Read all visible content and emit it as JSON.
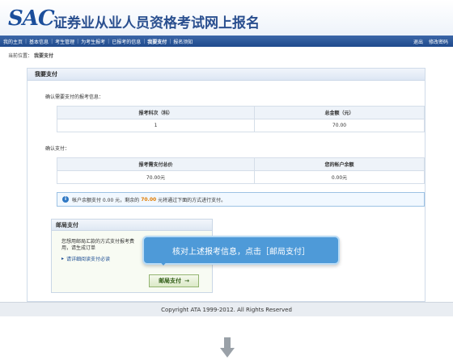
{
  "header": {
    "logo": "SAC",
    "title": "证券业从业人员资格考试网上报名"
  },
  "nav": {
    "items": [
      {
        "label": "我的主页",
        "active": false
      },
      {
        "label": "基本信息",
        "active": false
      },
      {
        "label": "考生管理",
        "active": false
      },
      {
        "label": "为考生报考",
        "active": false
      },
      {
        "label": "已报考的信息",
        "active": false
      },
      {
        "label": "我要支付",
        "active": true
      },
      {
        "label": "报名须知",
        "active": false
      }
    ],
    "logout": "退出",
    "change_password": "修改密码"
  },
  "breadcrumb": {
    "prefix": "当前位置：",
    "current": "我要支付"
  },
  "panel": {
    "title": "我要支付",
    "confirm_info_label": "确认需要支付的报考信息：",
    "table1": {
      "headers": [
        "报考科次（科）",
        "总金额（元）"
      ],
      "row": [
        "1",
        "70.00"
      ]
    },
    "confirm_pay_label": "确认支付：",
    "table2": {
      "headers": [
        "报考需支付总价",
        "您的帐户余额"
      ],
      "row": [
        "70.00元",
        "0.00元"
      ]
    },
    "notice": {
      "before": "帐户余额支付 0.00 元，剩余的",
      "amount": "70.00",
      "after": "元将通过下面的方式进行支付。"
    },
    "postal": {
      "title": "邮局支付",
      "text": "您想用邮局汇款的方式支付报考费用，请生成订单",
      "link": "请详细阅读支付必读",
      "button": "邮局支付"
    }
  },
  "callout": {
    "text": "核对上述报考信息，点击［邮局支付］"
  },
  "footer": {
    "copyright": "Copyright ATA 1999-2012. All Rights Reserved"
  }
}
